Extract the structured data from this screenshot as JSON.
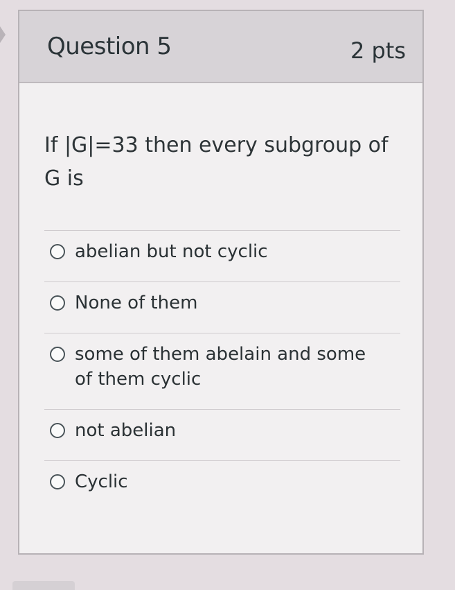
{
  "question": {
    "title": "Question 5",
    "points": "2 pts",
    "text": "If |G|=33 then every subgroup of G is"
  },
  "answers": [
    {
      "label": "abelian but not cyclic"
    },
    {
      "label": "None of them"
    },
    {
      "label": "some of them abelain and some of them cyclic"
    },
    {
      "label": "not abelian"
    },
    {
      "label": "Cyclic"
    }
  ],
  "icons": {
    "nav": "chevron-right-icon",
    "radio": "radio-button-icon"
  },
  "colors": {
    "header_bg": "#d7d3d7",
    "card_bg": "#f2f0f1",
    "text": "#2d3b45"
  }
}
